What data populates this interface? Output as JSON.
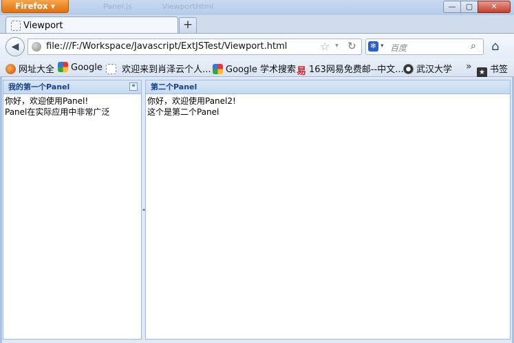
{
  "window": {
    "app_button": "Firefox ▾",
    "minimize": "—",
    "maximize": "▢",
    "close": "✕",
    "ghost_tabs": [
      "Panel.js",
      "ViewportHtml"
    ]
  },
  "tabs": [
    {
      "label": "Viewport"
    }
  ],
  "new_tab_label": "+",
  "nav": {
    "back": "◀",
    "url": "file:///F:/Workspace/Javascript/ExtJSTest/Viewport.html",
    "star": "☆",
    "dropdown": "▾",
    "reload": "↻",
    "search_engine_icon": "baidu-paw",
    "search_placeholder": "百度",
    "search_glyph": "⌕",
    "home": "⌂"
  },
  "bookmarks": [
    {
      "label": "网址大全",
      "icon": "firefox-icon"
    },
    {
      "label": "Google",
      "icon": "google-icon"
    },
    {
      "label": "欢迎来到肖泽云个人...",
      "icon": "blank-page-icon"
    },
    {
      "label": "Google 学术搜索",
      "icon": "google-icon"
    },
    {
      "label": "163网易免费邮--中文...",
      "icon": "netease-icon"
    },
    {
      "label": "武汉大学",
      "icon": "whu-icon"
    }
  ],
  "bookmarks_more": "»",
  "bookmarks_menu": "书签",
  "west_panel": {
    "title": "我的第一个Panel",
    "collapse_glyph": "«",
    "lines": [
      "你好，欢迎使用Panel!",
      "Panel在实际应用中非常广泛"
    ]
  },
  "center_panel": {
    "title": "第二个Panel",
    "lines": [
      "你好，欢迎使用Panel2!",
      "这个是第二个Panel"
    ]
  },
  "splitter_glyph": "◂"
}
